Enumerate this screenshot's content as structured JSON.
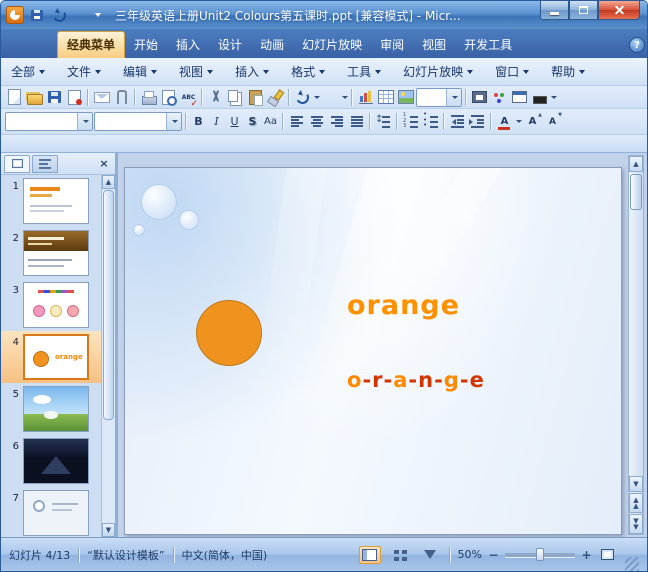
{
  "titlebar": {
    "title": "三年级英语上册Unit2 Colours第五课时.ppt [兼容模式] - Micr...",
    "icons": [
      "powerpoint-app-icon",
      "save-icon",
      "undo-icon",
      "redo-icon",
      "customize-quick-access-icon"
    ],
    "window_controls": [
      "minimize",
      "maximize",
      "close"
    ]
  },
  "ribbon": {
    "tabs": [
      {
        "label": "经典菜单",
        "active": true
      },
      {
        "label": "开始",
        "active": false
      },
      {
        "label": "插入",
        "active": false
      },
      {
        "label": "设计",
        "active": false
      },
      {
        "label": "动画",
        "active": false
      },
      {
        "label": "幻灯片放映",
        "active": false
      },
      {
        "label": "审阅",
        "active": false
      },
      {
        "label": "视图",
        "active": false
      },
      {
        "label": "开发工具",
        "active": false
      }
    ],
    "help_icon": "help-icon"
  },
  "menubar": {
    "items": [
      "全部",
      "文件",
      "编辑",
      "视图",
      "插入",
      "格式",
      "工具",
      "幻灯片放映",
      "窗口",
      "帮助"
    ]
  },
  "toolbar_row1_icons": [
    "new-file",
    "open-folder",
    "save",
    "permission",
    "email",
    "attach-file",
    "print",
    "print-preview",
    "spelling-check",
    "cut",
    "copy",
    "paste",
    "format-painter",
    "undo",
    "redo",
    "insert-chart",
    "insert-table",
    "insert-picture",
    "zoom-combo",
    "insert-media",
    "color-scheme",
    "new-window",
    "fill-color"
  ],
  "toolbar_row2": {
    "font_combo": "",
    "size_combo": "",
    "bold": "B",
    "italic": "I",
    "underline": "U",
    "shadow": "S",
    "change_case": "Aa",
    "icons": [
      "align-left",
      "align-center",
      "align-right",
      "justify",
      "line-spacing",
      "numbering",
      "bullets",
      "decrease-indent",
      "increase-indent",
      "font-color",
      "grow-font",
      "shrink-font"
    ],
    "font_color_glyph": "A",
    "grow_font_glyph": "A",
    "shrink_font_glyph": "A",
    "spelling_glyph": "ABC"
  },
  "sidebar": {
    "tabs": [
      "outline-tab",
      "slides-tab"
    ],
    "slides": [
      {
        "num": "1"
      },
      {
        "num": "2"
      },
      {
        "num": "3"
      },
      {
        "num": "4"
      },
      {
        "num": "5"
      },
      {
        "num": "6"
      },
      {
        "num": "7"
      }
    ],
    "selected_slide": 4
  },
  "slide": {
    "word": "orange",
    "circle_color": "#f0921e",
    "spelling": [
      {
        "t": "o",
        "c": "#ff8a00"
      },
      {
        "t": "-",
        "c": "#d43500"
      },
      {
        "t": "r",
        "c": "#d43500"
      },
      {
        "t": "-",
        "c": "#d43500"
      },
      {
        "t": "a",
        "c": "#ff8a00"
      },
      {
        "t": "-",
        "c": "#d43500"
      },
      {
        "t": "n",
        "c": "#d43500"
      },
      {
        "t": "-",
        "c": "#d43500"
      },
      {
        "t": "g",
        "c": "#ff8a00"
      },
      {
        "t": "-",
        "c": "#d43500"
      },
      {
        "t": "e",
        "c": "#d43500"
      }
    ]
  },
  "statusbar": {
    "slide_indicator": "幻灯片 4/13",
    "template_name": "“默认设计模板”",
    "language": "中文(简体，中国)",
    "zoom": "50%",
    "view_icons": [
      "normal-view",
      "slide-sorter-view",
      "slideshow-view"
    ]
  }
}
